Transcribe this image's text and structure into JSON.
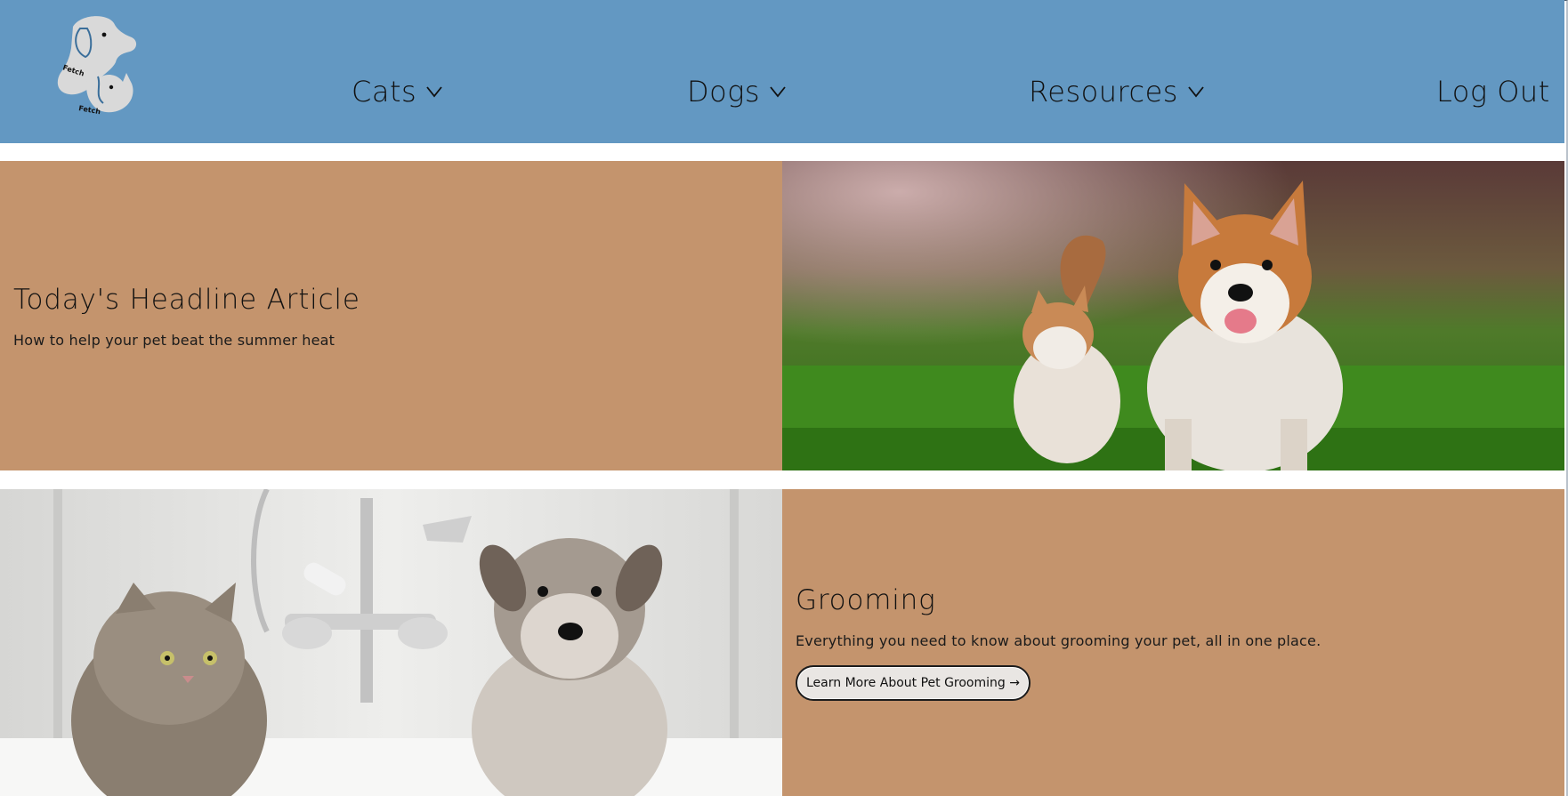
{
  "header": {
    "logo_text_top": "Fetch",
    "logo_text_bottom": "Fetch",
    "nav": [
      {
        "label": "Cats",
        "dropdown": true
      },
      {
        "label": "Dogs",
        "dropdown": true
      },
      {
        "label": "Resources",
        "dropdown": true
      },
      {
        "label": "Log Out",
        "dropdown": false
      }
    ]
  },
  "featured": {
    "title": "Today's Headline Article",
    "subtitle": "How to help your pet beat the summer heat"
  },
  "grooming": {
    "title": "Grooming",
    "subtitle": "Everything you need to know about grooming your pet, all in one place.",
    "button_label": "Learn More About Pet Grooming →"
  },
  "colors": {
    "header_bg": "#6398c2",
    "panel_bg": "#c4946d"
  }
}
